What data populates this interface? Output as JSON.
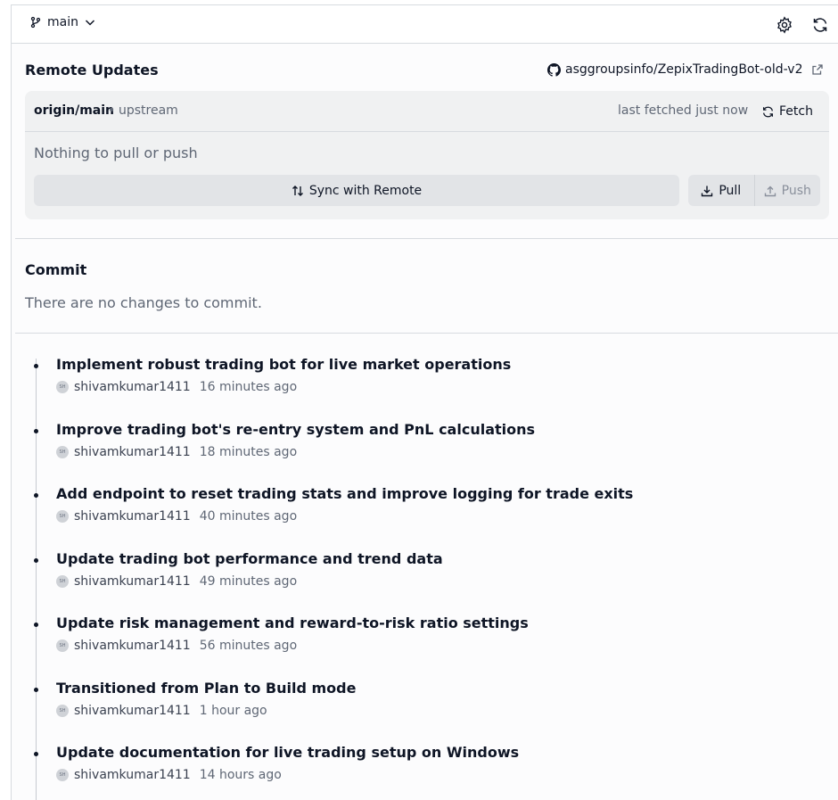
{
  "topbar": {
    "branch": "main",
    "icons": [
      "branch-icon",
      "chevron-down-icon",
      "gear-icon",
      "refresh-icon"
    ]
  },
  "remote": {
    "title": "Remote Updates",
    "repo": "asggroupsinfo/ZepixTradingBot-old-v2",
    "branch": "origin/main",
    "separator": "•",
    "upstream": "upstream",
    "last_fetched": "last fetched just now",
    "fetch_label": "Fetch",
    "status": "Nothing to pull or push",
    "sync_label": "Sync with Remote",
    "pull_label": "Pull",
    "push_label": "Push"
  },
  "commit": {
    "title": "Commit",
    "empty": "There are no changes to commit."
  },
  "history": [
    {
      "message": "Implement robust trading bot for live market operations",
      "avatar": "SH",
      "author": "shivamkumar1411",
      "time": "16 minutes ago"
    },
    {
      "message": "Improve trading bot's re-entry system and PnL calculations",
      "avatar": "SH",
      "author": "shivamkumar1411",
      "time": "18 minutes ago"
    },
    {
      "message": "Add endpoint to reset trading stats and improve logging for trade exits",
      "avatar": "SH",
      "author": "shivamkumar1411",
      "time": "40 minutes ago"
    },
    {
      "message": "Update trading bot performance and trend data",
      "avatar": "SH",
      "author": "shivamkumar1411",
      "time": "49 minutes ago"
    },
    {
      "message": "Update risk management and reward-to-risk ratio settings",
      "avatar": "SH",
      "author": "shivamkumar1411",
      "time": "56 minutes ago"
    },
    {
      "message": "Transitioned from Plan to Build mode",
      "avatar": "SH",
      "author": "shivamkumar1411",
      "time": "1 hour ago"
    },
    {
      "message": "Update documentation for live trading setup on Windows",
      "avatar": "SH",
      "author": "shivamkumar1411",
      "time": "14 hours ago"
    }
  ]
}
